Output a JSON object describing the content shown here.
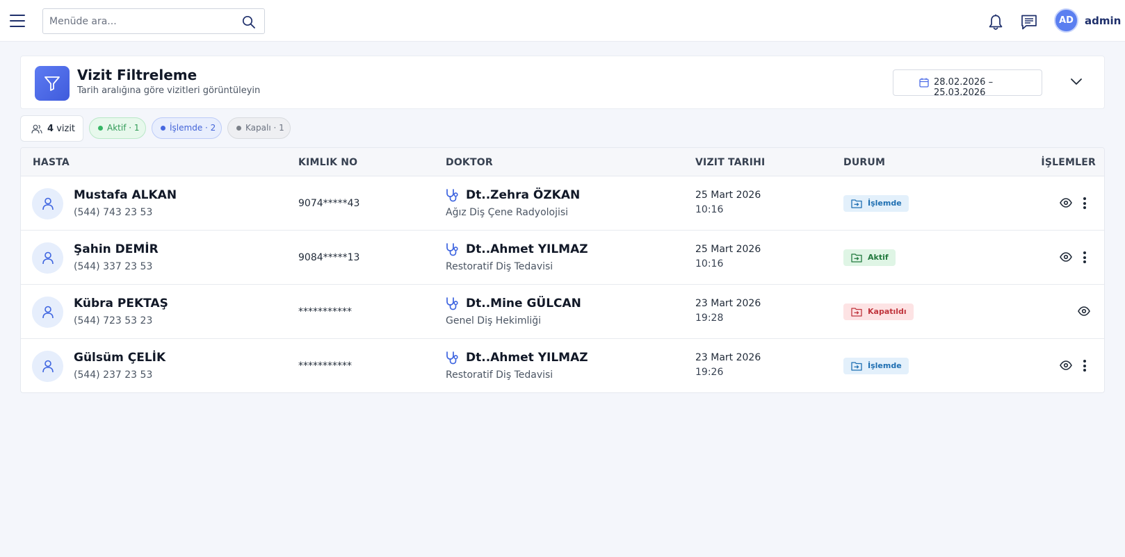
{
  "topbar": {
    "search_placeholder": "Menüde ara...",
    "user_initials": "AD",
    "username": "admin"
  },
  "filter": {
    "title": "Vizit Filtreleme",
    "subtitle": "Tarih aralığına göre vizitleri görüntüleyin",
    "date_range": "28.02.2026 – 25.03.2026"
  },
  "summary": {
    "count": "4",
    "count_label": "vizit",
    "pills": {
      "aktif": "Aktif · 1",
      "islemde": "İşlemde · 2",
      "kapali": "Kapalı · 1"
    }
  },
  "table": {
    "headers": {
      "hasta": "HASTA",
      "kimlik": "KIMLIK NO",
      "doktor": "DOKTOR",
      "tarih": "VIZIT TARIHI",
      "durum": "DURUM",
      "islemler": "İŞLEMLER"
    },
    "rows": [
      {
        "name": "Mustafa ALKAN",
        "phone": "(544) 743 23 53",
        "id": "9074*****43",
        "doctor": "Dt..Zehra ÖZKAN",
        "dept": "Ağız Diş Çene Radyolojisi",
        "date": "25 Mart 2026",
        "time": "10:16",
        "status": "İşlemde"
      },
      {
        "name": "Şahin DEMİR",
        "phone": "(544) 337 23 53",
        "id": "9084*****13",
        "doctor": "Dt..Ahmet YILMAZ",
        "dept": "Restoratif Diş Tedavisi",
        "date": "25 Mart 2026",
        "time": "10:16",
        "status": "Aktif"
      },
      {
        "name": "Kübra PEKTAŞ",
        "phone": "(544) 723 53 23",
        "id": "***********",
        "doctor": "Dt..Mine GÜLCAN",
        "dept": "Genel Diş Hekimliği",
        "date": "23 Mart 2026",
        "time": "19:28",
        "status": "Kapatıldı"
      },
      {
        "name": "Gülsüm ÇELİK",
        "phone": "(544) 237 23 53",
        "id": "***********",
        "doctor": "Dt..Ahmet YILMAZ",
        "dept": "Restoratif Diş Tedavisi",
        "date": "23 Mart 2026",
        "time": "19:26",
        "status": "İşlemde"
      }
    ]
  },
  "icons": {
    "menu": "menu-icon",
    "search": "search-icon",
    "bell": "bell-icon",
    "chat": "chat-icon",
    "filter": "filter-icon",
    "calendar": "calendar-icon",
    "chevron": "chevron-down-icon",
    "people": "users-icon",
    "patient": "user-icon",
    "doctor": "stethoscope-icon",
    "status": "folder-in-icon",
    "view": "eye-icon",
    "more": "kebab-icon"
  },
  "colors": {
    "accent": "#4a6ae6",
    "aktif": "#36b765",
    "islemde": "#4768e0",
    "kapali": "#7b8088",
    "kapatildi": "#c0353d"
  }
}
